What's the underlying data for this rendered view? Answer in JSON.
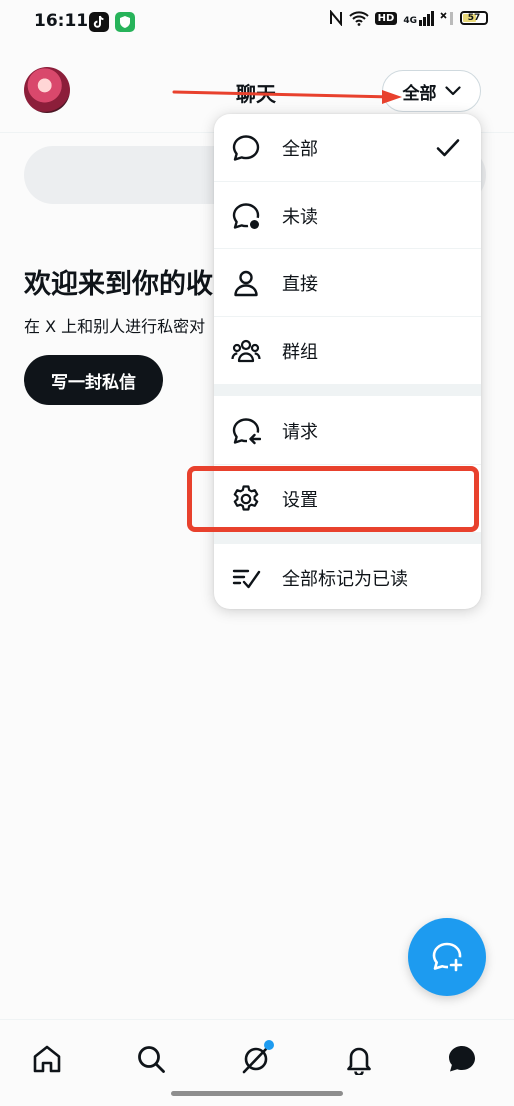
{
  "status_bar": {
    "time": "16:11",
    "network": "4G",
    "hd_label": "HD",
    "battery": "57"
  },
  "header": {
    "title": "聊天",
    "filter_label": "全部",
    "filter_icon": "chevron-down-icon"
  },
  "empty_state": {
    "heading": "欢迎来到你的收",
    "subtitle": "在 X 上和别人进行私密对",
    "compose_label": "写一封私信"
  },
  "menu": {
    "items": [
      {
        "label": "全部",
        "icon": "chat-bubble-icon",
        "selected": true
      },
      {
        "label": "未读",
        "icon": "unread-chat-icon"
      },
      {
        "label": "直接",
        "icon": "person-icon"
      },
      {
        "label": "群组",
        "icon": "group-icon"
      },
      {
        "label": "请求",
        "icon": "request-chat-icon"
      },
      {
        "label": "设置",
        "icon": "gear-icon"
      },
      {
        "label": "全部标记为已读",
        "icon": "mark-read-icon"
      }
    ]
  },
  "bottom_nav": {
    "items": [
      "home-icon",
      "search-icon",
      "grok-icon",
      "bell-icon",
      "messages-icon"
    ]
  },
  "colors": {
    "accent": "#1d9bf0",
    "annotation": "#e8412d",
    "text": "#0f1419"
  }
}
